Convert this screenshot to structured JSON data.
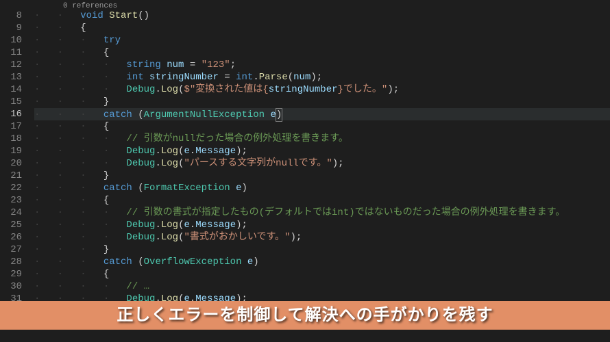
{
  "chart_data": null,
  "codelens": {
    "text": "0 references"
  },
  "gutter": {
    "start": 8,
    "end": 31,
    "highlighted": 16
  },
  "highlighted_line": 16,
  "lines": {
    "l8": [
      {
        "t": "kw",
        "v": "void"
      },
      {
        "t": "plain",
        "v": " "
      },
      {
        "t": "fn",
        "v": "Start"
      },
      {
        "t": "punct",
        "v": "()"
      }
    ],
    "l9": [
      {
        "t": "punct",
        "v": "{"
      }
    ],
    "l10": [
      {
        "t": "kw",
        "v": "try"
      }
    ],
    "l11": [
      {
        "t": "punct",
        "v": "{"
      }
    ],
    "l12": [
      {
        "t": "kw",
        "v": "string"
      },
      {
        "t": "plain",
        "v": " "
      },
      {
        "t": "var",
        "v": "num"
      },
      {
        "t": "plain",
        "v": " = "
      },
      {
        "t": "str",
        "v": "\"123\""
      },
      {
        "t": "punct",
        "v": ";"
      }
    ],
    "l13": [
      {
        "t": "kw",
        "v": "int"
      },
      {
        "t": "plain",
        "v": " "
      },
      {
        "t": "var",
        "v": "stringNumber"
      },
      {
        "t": "plain",
        "v": " = "
      },
      {
        "t": "kw",
        "v": "int"
      },
      {
        "t": "punct",
        "v": "."
      },
      {
        "t": "fn",
        "v": "Parse"
      },
      {
        "t": "punct",
        "v": "("
      },
      {
        "t": "var",
        "v": "num"
      },
      {
        "t": "punct",
        "v": ");"
      }
    ],
    "l14": [
      {
        "t": "type",
        "v": "Debug"
      },
      {
        "t": "punct",
        "v": "."
      },
      {
        "t": "fn",
        "v": "Log"
      },
      {
        "t": "punct",
        "v": "("
      },
      {
        "t": "str",
        "v": "$\"変換された値は{"
      },
      {
        "t": "var",
        "v": "stringNumber"
      },
      {
        "t": "str",
        "v": "}でした。\""
      },
      {
        "t": "punct",
        "v": ");"
      }
    ],
    "l15": [
      {
        "t": "punct",
        "v": "}"
      }
    ],
    "l16": [
      {
        "t": "kw",
        "v": "catch"
      },
      {
        "t": "plain",
        "v": " "
      },
      {
        "t": "punct",
        "v": "("
      },
      {
        "t": "type",
        "v": "ArgumentNullException"
      },
      {
        "t": "plain",
        "v": " "
      },
      {
        "t": "var",
        "v": "e"
      },
      {
        "t": "punct",
        "v": ")"
      }
    ],
    "l17": [
      {
        "t": "punct",
        "v": "{"
      }
    ],
    "l18": [
      {
        "t": "comment",
        "v": "// 引数がnullだった場合の例外処理を書きます。"
      }
    ],
    "l19": [
      {
        "t": "type",
        "v": "Debug"
      },
      {
        "t": "punct",
        "v": "."
      },
      {
        "t": "fn",
        "v": "Log"
      },
      {
        "t": "punct",
        "v": "("
      },
      {
        "t": "var",
        "v": "e"
      },
      {
        "t": "punct",
        "v": "."
      },
      {
        "t": "var",
        "v": "Message"
      },
      {
        "t": "punct",
        "v": ");"
      }
    ],
    "l20": [
      {
        "t": "type",
        "v": "Debug"
      },
      {
        "t": "punct",
        "v": "."
      },
      {
        "t": "fn",
        "v": "Log"
      },
      {
        "t": "punct",
        "v": "("
      },
      {
        "t": "str",
        "v": "\"パースする文字列がnullです。\""
      },
      {
        "t": "punct",
        "v": ");"
      }
    ],
    "l21": [
      {
        "t": "punct",
        "v": "}"
      }
    ],
    "l22": [
      {
        "t": "kw",
        "v": "catch"
      },
      {
        "t": "plain",
        "v": " ("
      },
      {
        "t": "type",
        "v": "FormatException"
      },
      {
        "t": "plain",
        "v": " "
      },
      {
        "t": "var",
        "v": "e"
      },
      {
        "t": "punct",
        "v": ")"
      }
    ],
    "l23": [
      {
        "t": "punct",
        "v": "{"
      }
    ],
    "l24": [
      {
        "t": "comment",
        "v": "// 引数の書式が指定したもの(デフォルトではint)ではないものだった場合の例外処理を書きます。"
      }
    ],
    "l25": [
      {
        "t": "type",
        "v": "Debug"
      },
      {
        "t": "punct",
        "v": "."
      },
      {
        "t": "fn",
        "v": "Log"
      },
      {
        "t": "punct",
        "v": "("
      },
      {
        "t": "var",
        "v": "e"
      },
      {
        "t": "punct",
        "v": "."
      },
      {
        "t": "var",
        "v": "Message"
      },
      {
        "t": "punct",
        "v": ");"
      }
    ],
    "l26": [
      {
        "t": "type",
        "v": "Debug"
      },
      {
        "t": "punct",
        "v": "."
      },
      {
        "t": "fn",
        "v": "Log"
      },
      {
        "t": "punct",
        "v": "("
      },
      {
        "t": "str",
        "v": "\"書式がおかしいです。\""
      },
      {
        "t": "punct",
        "v": ");"
      }
    ],
    "l27": [
      {
        "t": "punct",
        "v": "}"
      }
    ],
    "l28": [
      {
        "t": "kw",
        "v": "catch"
      },
      {
        "t": "plain",
        "v": " ("
      },
      {
        "t": "type",
        "v": "OverflowException"
      },
      {
        "t": "plain",
        "v": " "
      },
      {
        "t": "var",
        "v": "e"
      },
      {
        "t": "punct",
        "v": ")"
      }
    ],
    "l29": [
      {
        "t": "punct",
        "v": "{"
      }
    ],
    "l30": [
      {
        "t": "comment",
        "v": "// …"
      }
    ],
    "l31": [
      {
        "t": "type",
        "v": "Debug"
      },
      {
        "t": "punct",
        "v": "."
      },
      {
        "t": "fn",
        "v": "Log"
      },
      {
        "t": "punct",
        "v": "("
      },
      {
        "t": "var",
        "v": "e"
      },
      {
        "t": "punct",
        "v": "."
      },
      {
        "t": "var",
        "v": "Message"
      },
      {
        "t": "punct",
        "v": ");"
      }
    ]
  },
  "indents": {
    "l8": 2,
    "l9": 2,
    "l10": 3,
    "l11": 3,
    "l12": 4,
    "l13": 4,
    "l14": 4,
    "l15": 3,
    "l16": 3,
    "l17": 3,
    "l18": 4,
    "l19": 4,
    "l20": 4,
    "l21": 3,
    "l22": 3,
    "l23": 3,
    "l24": 4,
    "l25": 4,
    "l26": 4,
    "l27": 3,
    "l28": 3,
    "l29": 3,
    "l30": 4,
    "l31": 4
  },
  "overlay": {
    "caption": "正しくエラーを制御して解決への手がかりを残す",
    "background_color": "#e28f66"
  }
}
